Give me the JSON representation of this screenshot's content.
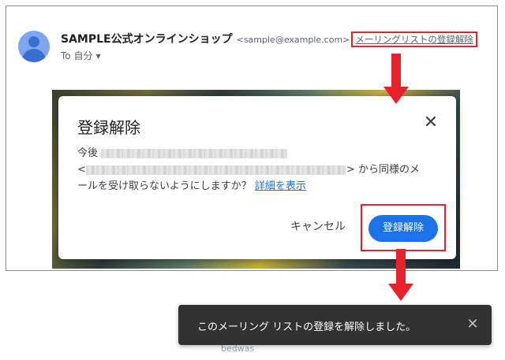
{
  "email": {
    "sender_name": "SAMPLE公式オンラインショップ",
    "sender_email": "<sample@example.com>",
    "unsubscribe_link": "メーリングリストの登録解除",
    "to_line": "To 自分",
    "to_caret_icon": "caret-down-icon"
  },
  "dialog": {
    "title": "登録解除",
    "close_icon": "close-icon",
    "body_prefix": "今後",
    "body_lt": "<",
    "body_gt": ">",
    "body_text_1": "から同様のメ",
    "body_text_2": "ールを受け取らないようにしますか？",
    "details_link": "詳細を表示",
    "cancel_label": "キャンセル",
    "confirm_label": "登録解除"
  },
  "toast": {
    "message": "このメーリング リストの登録を解除しました。",
    "close_icon": "close-icon"
  },
  "background": {
    "partial_text": "bedwas"
  },
  "colors": {
    "highlight": "#e8202a",
    "primary": "#1a73e8",
    "toast_bg": "#323232"
  }
}
